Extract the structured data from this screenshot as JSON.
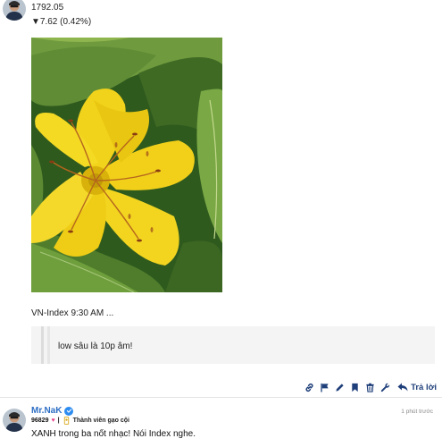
{
  "top_post": {
    "price": "1792.05",
    "change": "▼7.62 (0.42%)",
    "caption": "VN-Index 9:30 AM ...",
    "quote": "low sâu là 10p âm!"
  },
  "post_actions": {
    "icons": [
      "link-icon",
      "flag-icon",
      "edit-icon",
      "bookmark-icon",
      "delete-icon",
      "wrench-icon"
    ],
    "reply_label": "Trả lời"
  },
  "second_post": {
    "username": "Mr.NaK",
    "timestamp": "1 phút trước",
    "score": "96829",
    "rank": "Thành viên gạo cội",
    "text": "XANH trong ba nốt nhạc! Nói Index nghe."
  },
  "colors": {
    "username": "#2e6fc4",
    "reply": "#1f3f7a",
    "heart": "#e8438a",
    "verified": "#2d8cf0"
  }
}
